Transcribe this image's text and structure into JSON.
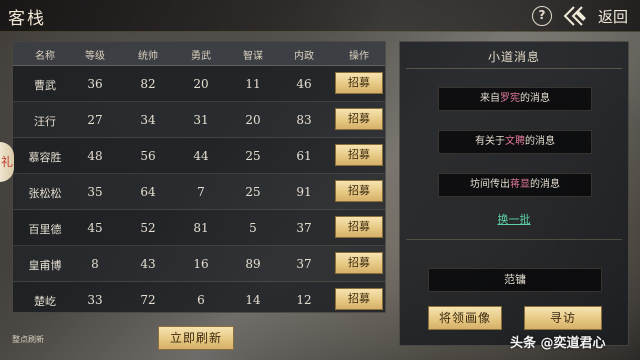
{
  "header": {
    "title": "客栈",
    "help_label": "?",
    "back_label": "返回"
  },
  "table": {
    "columns": [
      "名称",
      "等级",
      "统帅",
      "勇武",
      "智谋",
      "内政",
      "操作"
    ],
    "rows": [
      {
        "name": "曹武",
        "level": "36",
        "command": "82",
        "valor": "20",
        "wisdom": "11",
        "politics": "46",
        "action": "招募"
      },
      {
        "name": "汪行",
        "level": "27",
        "command": "34",
        "valor": "31",
        "wisdom": "20",
        "politics": "83",
        "action": "招募"
      },
      {
        "name": "慕容胜",
        "level": "48",
        "command": "56",
        "valor": "44",
        "wisdom": "25",
        "politics": "61",
        "action": "招募"
      },
      {
        "name": "张松松",
        "level": "35",
        "command": "64",
        "valor": "7",
        "wisdom": "25",
        "politics": "91",
        "action": "招募"
      },
      {
        "name": "百里德",
        "level": "45",
        "command": "52",
        "valor": "81",
        "wisdom": "5",
        "politics": "37",
        "action": "招募"
      },
      {
        "name": "皇甫博",
        "level": "8",
        "command": "43",
        "valor": "16",
        "wisdom": "89",
        "politics": "37",
        "action": "招募"
      },
      {
        "name": "楚屹",
        "level": "33",
        "command": "72",
        "valor": "6",
        "wisdom": "14",
        "politics": "12",
        "action": "招募"
      }
    ],
    "side_tab_label": "礼",
    "refresh_note": "整点刷新",
    "refresh_button": "立即刷新"
  },
  "news": {
    "title": "小道消息",
    "items": [
      {
        "prefix": "来自",
        "name": "罗宪",
        "suffix": "的消息"
      },
      {
        "prefix": "有关于",
        "name": "文聘",
        "suffix": "的消息"
      },
      {
        "prefix": "坊间传出",
        "name": "蒋显",
        "suffix": "的消息"
      }
    ],
    "swap_label": "换一批",
    "target_name": "范镛",
    "portrait_button": "将领画像",
    "visit_button": "寻访"
  },
  "watermark": "头条 @奕道君心",
  "colors": {
    "gold_button": "#e5c680",
    "name_highlight": "#e07a9a",
    "link": "#5fd0a6"
  }
}
